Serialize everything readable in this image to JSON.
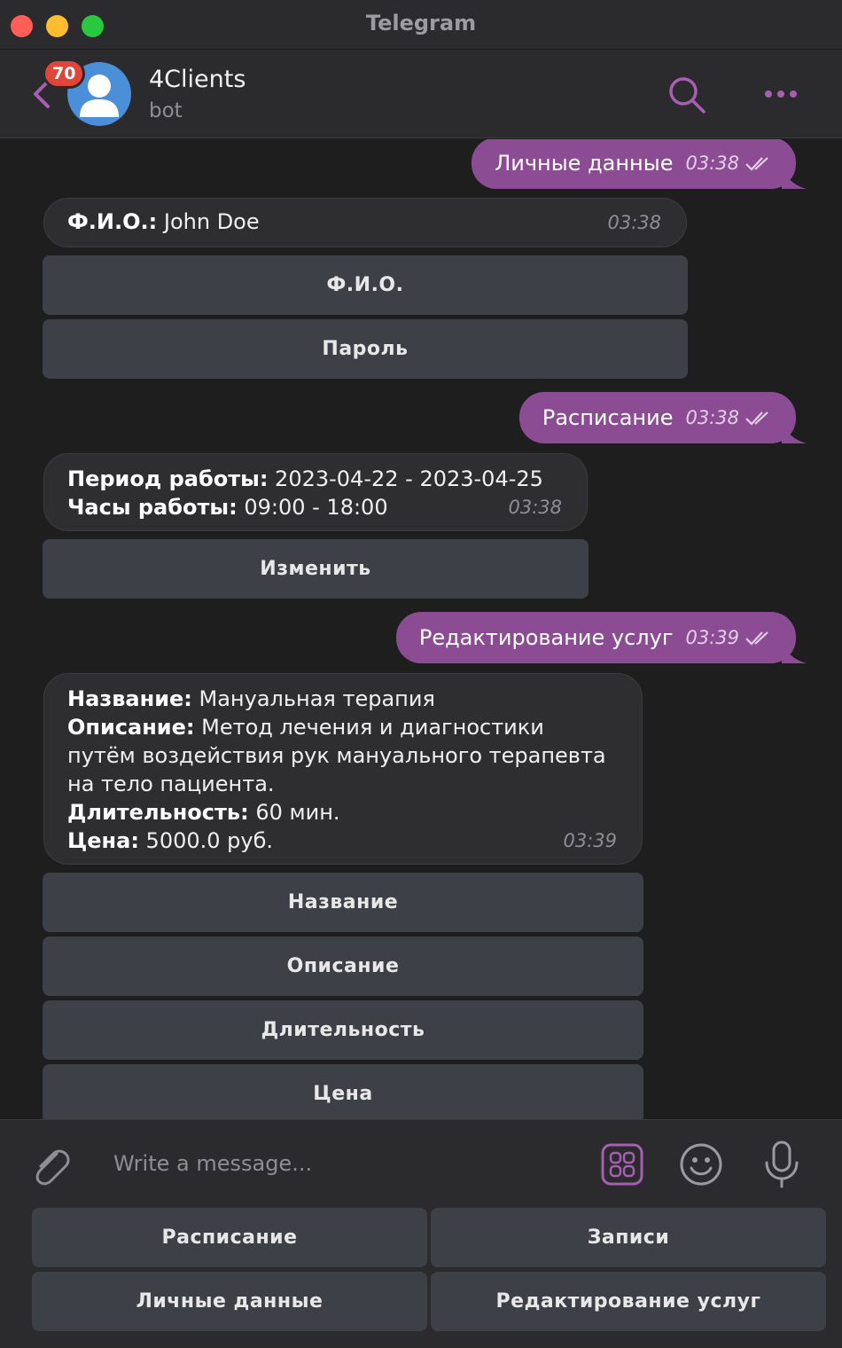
{
  "window": {
    "title": "Telegram"
  },
  "chat": {
    "name": "4Clients",
    "subtitle": "bot",
    "unread_badge": "70",
    "search_placeholder": "Write a message..."
  },
  "messages": [
    {
      "text": "Личные данные",
      "time": "03:38"
    },
    {
      "time": "03:38",
      "lines": [
        {
          "label": "Ф.И.О.:",
          "value": " John Doe"
        }
      ]
    },
    {
      "text": "Расписание",
      "time": "03:38"
    },
    {
      "time": "03:38",
      "lines": [
        {
          "label": "Период работы:",
          "value": " 2023-04-22 - 2023-04-25"
        },
        {
          "label": "Часы работы:",
          "value": " 09:00 - 18:00"
        }
      ]
    },
    {
      "text": "Редактирование услуг",
      "time": "03:39"
    },
    {
      "time": "03:39",
      "lines": [
        {
          "label": "Название:",
          "value": " Мануальная терапия"
        },
        {
          "label": "Описание:",
          "value": " Метод лечения и диагностики путём воздействия рук мануального терапевта на тело пациента."
        },
        {
          "label": "Длительность:",
          "value": " 60 мин."
        },
        {
          "label": "Цена:",
          "value": " 5000.0 руб."
        }
      ]
    }
  ],
  "inline_buttons": {
    "profile": [
      "Ф.И.О.",
      "Пароль"
    ],
    "schedule": [
      "Изменить"
    ],
    "service": [
      "Название",
      "Описание",
      "Длительность",
      "Цена"
    ]
  },
  "reply_keyboard": [
    "Расписание",
    "Записи",
    "Личные данные",
    "Редактирование услуг"
  ],
  "colors": {
    "accent": "#8b4c94",
    "background": "#1e1e1e",
    "panel": "#2b2b2d",
    "button": "#3e4048"
  },
  "icons": [
    "back-arrow-icon",
    "avatar-icon",
    "search-icon",
    "more-icon",
    "read-check-icon",
    "attach-icon",
    "bot-commands-icon",
    "emoji-icon",
    "mic-icon"
  ]
}
